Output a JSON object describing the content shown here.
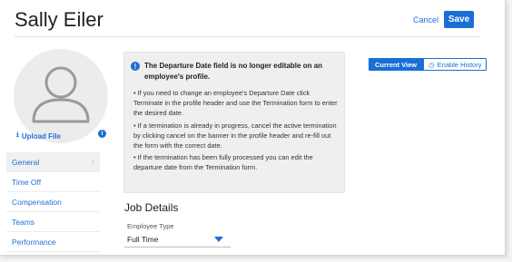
{
  "header": {
    "title": "Sally Eiler",
    "cancel_label": "Cancel",
    "save_label": "Save"
  },
  "profile": {
    "upload_label": "Upload File"
  },
  "view_toggle": {
    "current_label": "Current View",
    "history_label": "Enable History"
  },
  "notice": {
    "heading": "The Departure Date field is no longer editable on an employee's profile.",
    "bullets": [
      "• If you need to change an employee's Departure Date click Terminate in the profile header and use the Termination form to enter the desired date.",
      "• If a termination is already in progress, cancel the active termination by clicking cancel on the banner in the profile header and re-fill out the form with the correct date.",
      "• If the termination has been fully processed you can edit the departure date from the Termination form."
    ]
  },
  "sidebar": {
    "items": [
      {
        "label": "General"
      },
      {
        "label": "Time Off"
      },
      {
        "label": "Compensation"
      },
      {
        "label": "Teams"
      },
      {
        "label": "Performance"
      }
    ]
  },
  "job_details": {
    "title": "Job Details",
    "employee_type_label": "Employee Type",
    "employee_type_value": "Full Time"
  },
  "colors": {
    "accent": "#1a6fd4",
    "notice_bg": "#efefef"
  }
}
